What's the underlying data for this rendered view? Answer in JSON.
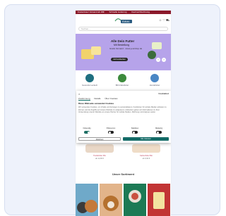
{
  "topbar": {
    "items": [
      "Kostenloser Versand ab 29€",
      "Schnelle Lieferung",
      "Kauf auf Rechnung"
    ]
  },
  "header": {
    "logo_text": "EMMA",
    "search_placeholder": "Suchen...",
    "icons": [
      "user-icon",
      "heart-icon",
      "cart-icon"
    ]
  },
  "hero": {
    "title": "Alle Dein Futter",
    "subtitle": "Mit Bestellung",
    "detail": "Gratis Versand · www.yourshop.de",
    "button": "Jetzt entdecken",
    "prev": "‹",
    "next": "›",
    "colors": {
      "background": "#b6a3ea"
    }
  },
  "categories": [
    {
      "label": "Gesunde Leckerli",
      "icon": "treat-icon",
      "color": "#1f6f80"
    },
    {
      "label": "BIO-Nassfutter",
      "icon": "leaf-icon",
      "color": "#3c8a3c"
    },
    {
      "label": "Hundefutter",
      "icon": "bowl-icon",
      "color": "#4a86c5"
    }
  ],
  "cookie_dialog": {
    "close": "×",
    "brand": "Cookiebot",
    "tabs": [
      "Zustimmung",
      "Details",
      "Über Cookies"
    ],
    "active_tab": 0,
    "title": "Diese Webseite verwendet Cookies",
    "body": "Wir verwenden Cookies, um Inhalte und Anzeigen zu personalisieren, Funktionen für soziale Medien anbieten zu können und die Zugriffe auf unsere Website zu analysieren. Außerdem geben wir Informationen zu Ihrer Verwendung unserer Website an unsere Partner für soziale Medien, Werbung und Analysen weiter.",
    "toggles": [
      {
        "label": "Notwendig",
        "on": true
      },
      {
        "label": "Präferenzen",
        "on": false
      },
      {
        "label": "Statistiken",
        "on": false
      },
      {
        "label": "Marketing",
        "on": false
      }
    ],
    "deny_label": "Ablehnen",
    "allow_label": "Alle zulassen",
    "colors": {
      "accent": "#146b67"
    }
  },
  "products": [
    {
      "name": "Hundefutter Mix",
      "price": "ab 12,90 €"
    },
    {
      "name": "Katzenfutter Bio",
      "price": "ab 9,90 €"
    }
  ],
  "section": {
    "title": "Unser Sortiment"
  },
  "tiles": [
    {
      "name": "dog-cat-tile",
      "color": "#6fa9c9"
    },
    {
      "name": "dog-tile",
      "color": "#e2b48a"
    },
    {
      "name": "food-bowl-tile",
      "color": "#1c7a55"
    },
    {
      "name": "product-pack-tile",
      "color": "#c23434"
    }
  ]
}
